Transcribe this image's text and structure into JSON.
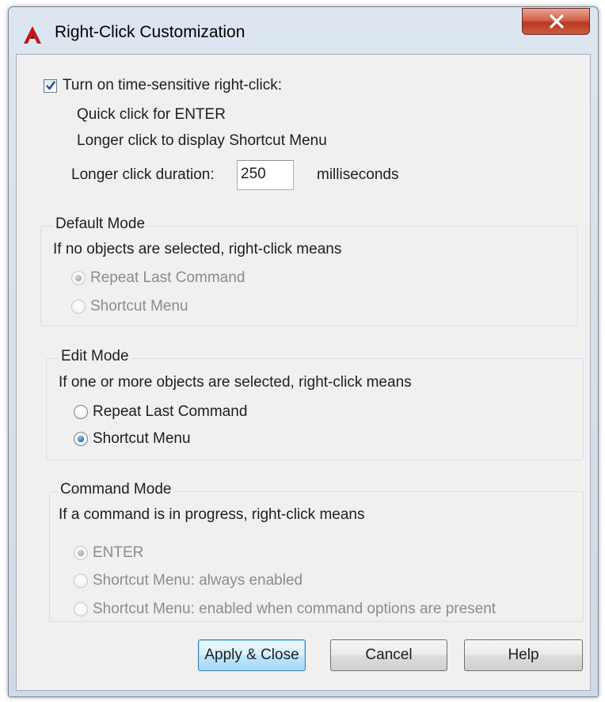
{
  "window": {
    "title": "Right-Click Customization",
    "app_icon": "autocad-a-icon",
    "close_icon": "close-x-icon",
    "accent_colors": {
      "close": "#c9452b",
      "app_icon": "#c4161c",
      "radio_dot": "#1c5d99"
    }
  },
  "time_sensitive": {
    "checkbox_label": "Turn on time-sensitive right-click:",
    "checked": true,
    "line1": "Quick click for ENTER",
    "line2": "Longer click to display Shortcut Menu",
    "duration_label": "Longer click duration:",
    "duration_value": "250",
    "duration_unit": "milliseconds"
  },
  "default_mode": {
    "title": "Default Mode",
    "description": "If no objects are selected, right-click means",
    "enabled": false,
    "options": [
      {
        "label": "Repeat Last Command",
        "selected": true
      },
      {
        "label": "Shortcut Menu",
        "selected": false
      }
    ]
  },
  "edit_mode": {
    "title": "Edit Mode",
    "description": "If one or more objects are selected, right-click means",
    "enabled": true,
    "options": [
      {
        "label": "Repeat Last Command",
        "selected": false
      },
      {
        "label": "Shortcut Menu",
        "selected": true
      }
    ]
  },
  "command_mode": {
    "title": "Command Mode",
    "description": "If a command is in progress, right-click means",
    "enabled": false,
    "options": [
      {
        "label": "ENTER",
        "selected": true
      },
      {
        "label": "Shortcut Menu: always enabled",
        "selected": false
      },
      {
        "label": "Shortcut Menu: enabled when command options are present",
        "selected": false
      }
    ]
  },
  "buttons": {
    "apply_close": "Apply & Close",
    "cancel": "Cancel",
    "help": "Help"
  }
}
